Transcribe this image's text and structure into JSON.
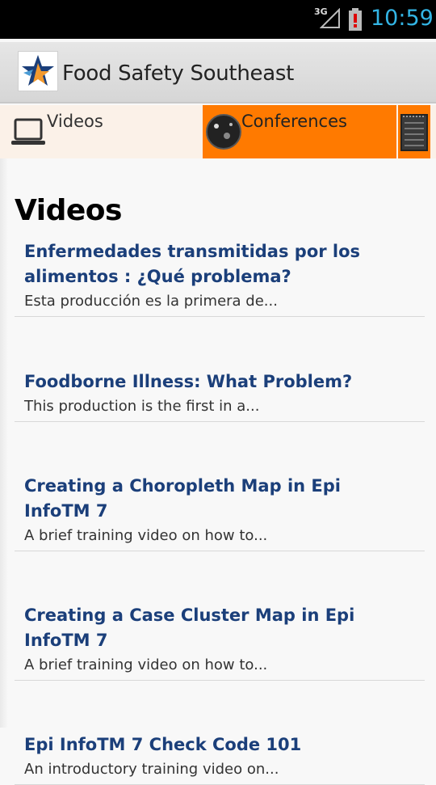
{
  "status_bar": {
    "network": "3G",
    "time": "10:59",
    "icons": [
      "signal-icon",
      "battery-alert-icon"
    ]
  },
  "action_bar": {
    "title": "Food Safety Southeast",
    "logo": "star-logo-icon"
  },
  "tabs": [
    {
      "label": "Videos",
      "icon": "laptop-icon",
      "selected": false
    },
    {
      "label": "Conferences",
      "icon": "globe-icon",
      "selected": true
    },
    {
      "label": "",
      "icon": "notepad-icon",
      "selected": true
    }
  ],
  "section": {
    "title": "Videos"
  },
  "videos": [
    {
      "title": "Enfermedades transmitidas por los alimentos : ¿Qué problema?",
      "description": "Esta producción es la primera de..."
    },
    {
      "title": "Foodborne Illness: What Problem?",
      "description": "This production is the first in a..."
    },
    {
      "title": "Creating a Choropleth Map in Epi InfoTM 7",
      "description": "A brief training video on how to..."
    },
    {
      "title": "Creating a Case Cluster Map in Epi InfoTM 7",
      "description": "A brief training video on how to..."
    },
    {
      "title": "Epi InfoTM 7 Check Code 101",
      "description": "An introductory training video on..."
    }
  ],
  "colors": {
    "accent": "#ff7a00",
    "link": "#1b3f7a",
    "status_time": "#33b5e5"
  }
}
